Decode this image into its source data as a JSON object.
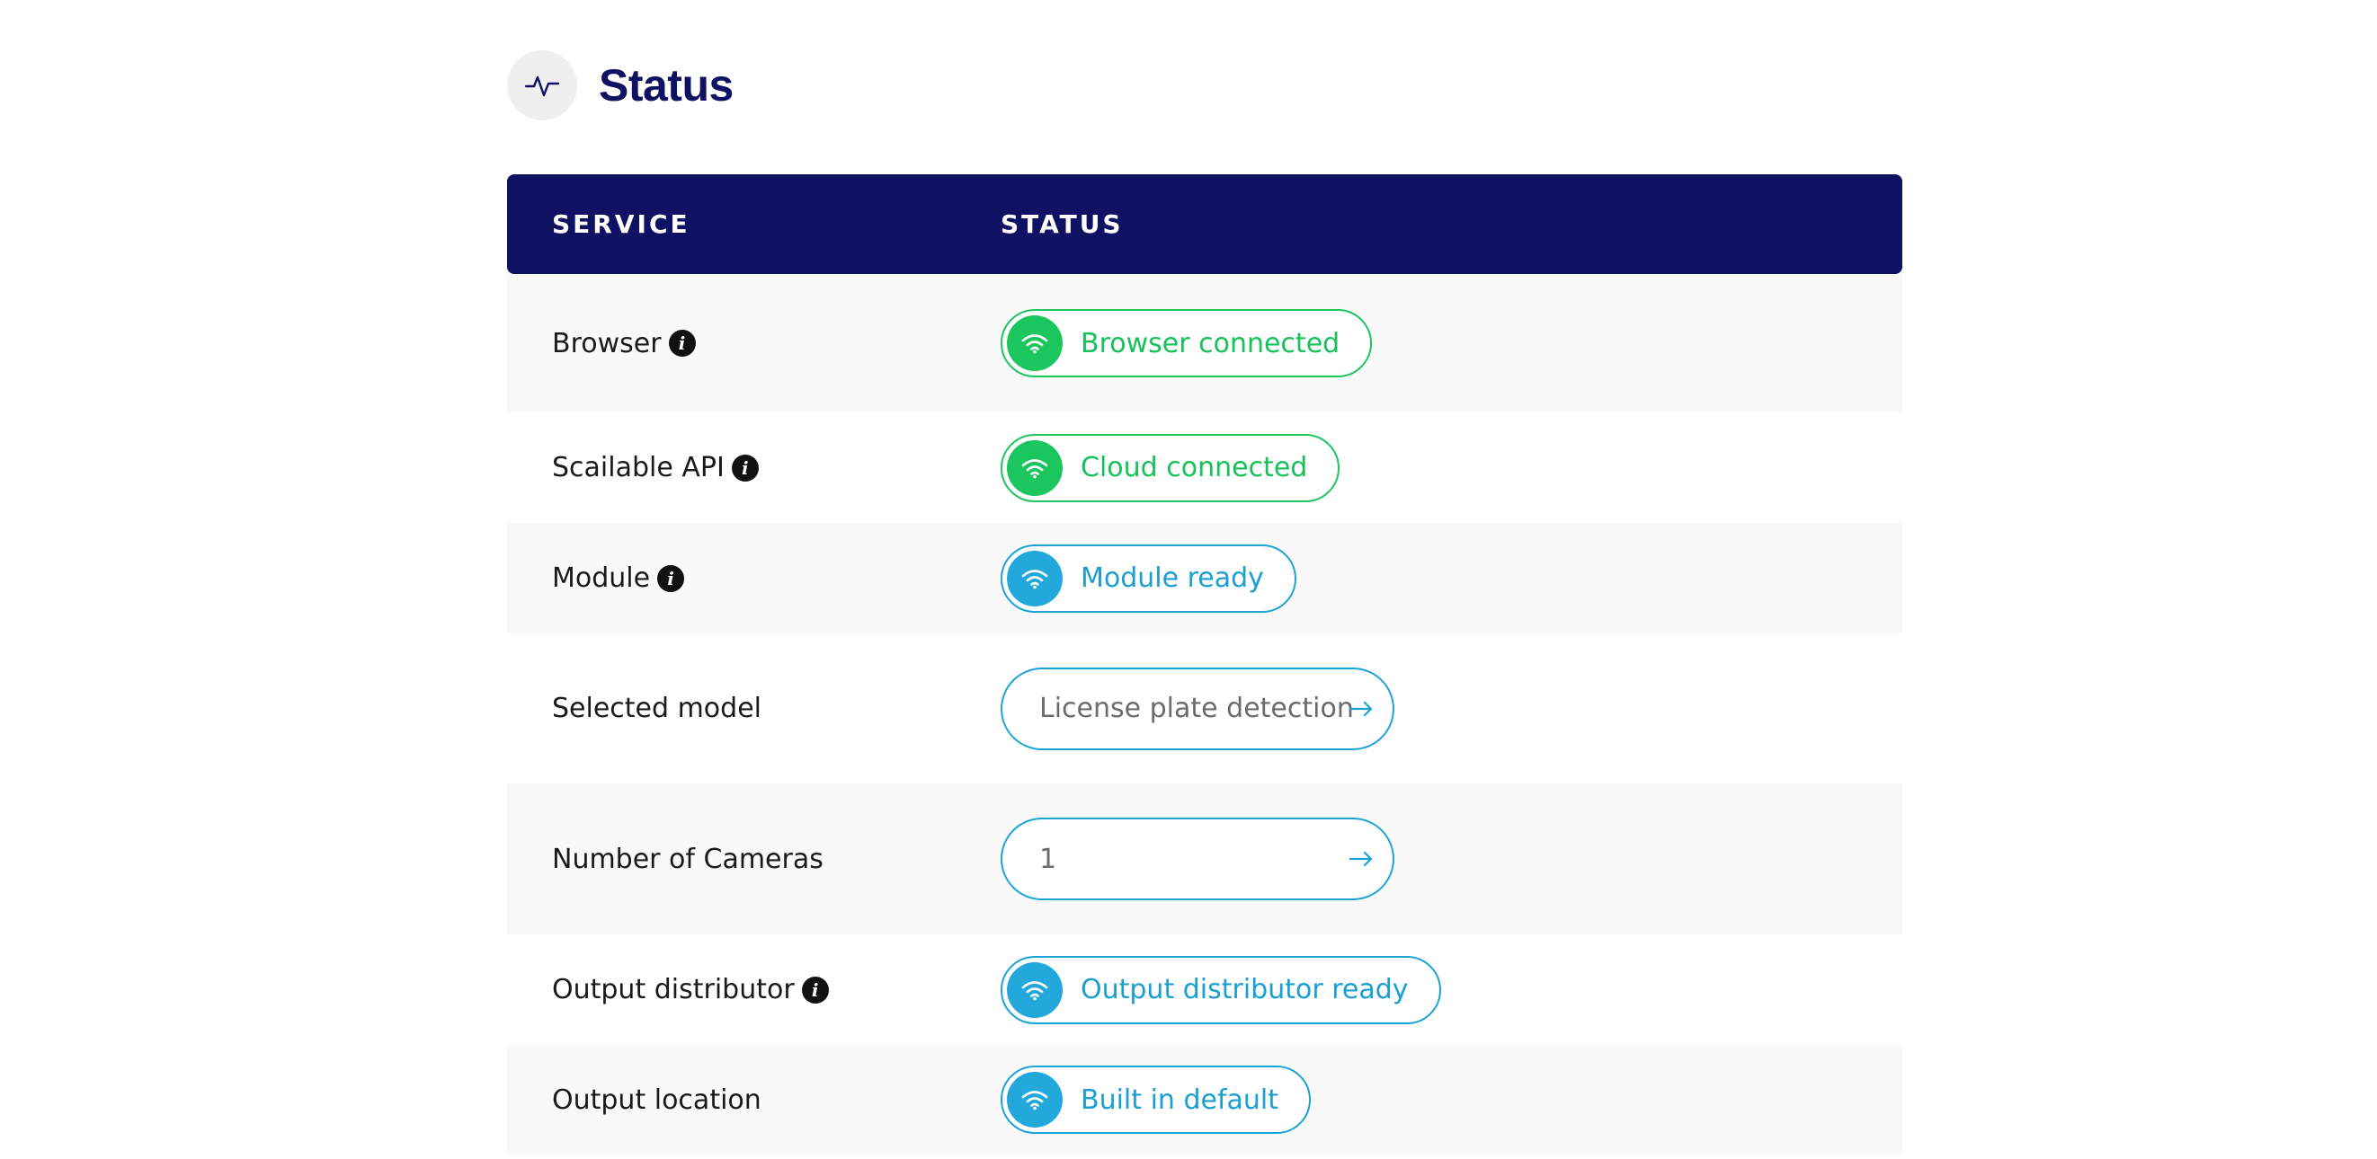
{
  "header": {
    "icon": "activity-icon",
    "title": "Status"
  },
  "table": {
    "columns": {
      "service": "SERVICE",
      "status": "STATUS"
    },
    "rows": [
      {
        "service": "Browser",
        "info": true,
        "kind": "status",
        "status": "Browser connected",
        "state": "connected",
        "color": "#1cc65f"
      },
      {
        "service": "Scailable API",
        "info": true,
        "kind": "status",
        "status": "Cloud connected",
        "state": "connected",
        "color": "#1cc65f"
      },
      {
        "service": "Module",
        "info": true,
        "kind": "status",
        "status": "Module ready",
        "state": "ready",
        "color": "#23a8dc"
      },
      {
        "service": "Selected model",
        "info": false,
        "kind": "select",
        "value": "License plate detection"
      },
      {
        "service": "Number of Cameras",
        "info": false,
        "kind": "select",
        "value": "1"
      },
      {
        "service": "Output distributor",
        "info": true,
        "kind": "status",
        "status": "Output distributor ready",
        "state": "ready",
        "color": "#23a8dc"
      },
      {
        "service": "Output location",
        "info": false,
        "kind": "status",
        "status": "Built in default",
        "state": "ready",
        "color": "#23a8dc"
      }
    ]
  },
  "icons": {
    "info": "info-icon",
    "status": "wifi-icon",
    "select": "arrow-right-icon"
  },
  "colors": {
    "header_bg": "#101163",
    "connected": "#1cc65f",
    "ready": "#23a8dc"
  }
}
